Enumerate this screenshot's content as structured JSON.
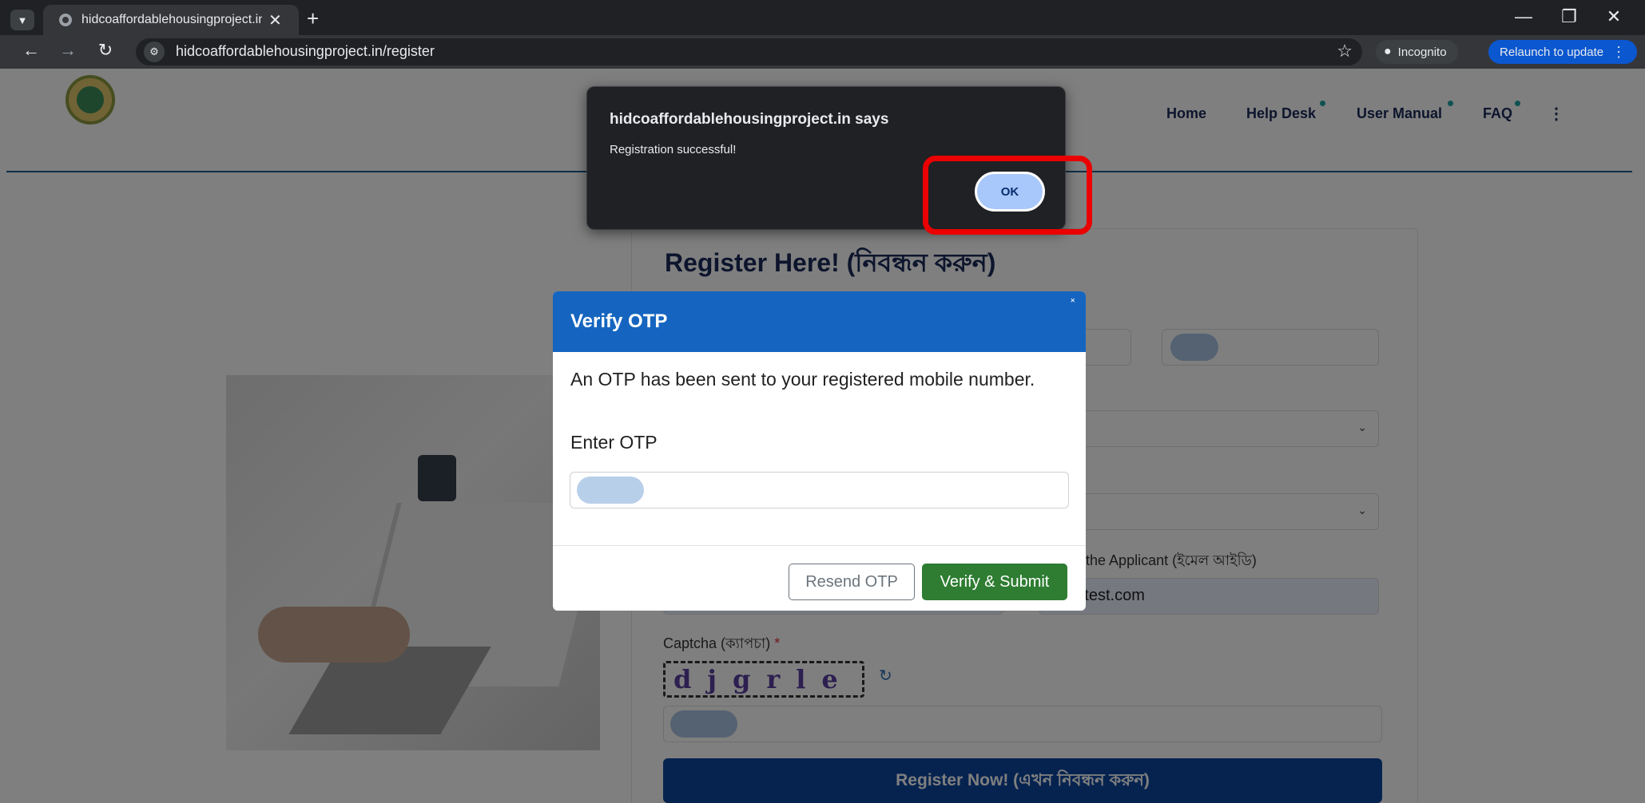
{
  "browser": {
    "tab_title": "hidcoaffordablehousingproject.in",
    "tab_close": "✕",
    "new_tab": "+",
    "url": "hidcoaffordablehousingproject.in/register",
    "incognito_label": "Incognito",
    "relaunch_label": "Relaunch to update",
    "icons": [
      "chevron-down-icon",
      "globe-icon",
      "close-icon",
      "plus-icon",
      "back-icon",
      "forward-icon",
      "reload-icon",
      "site-info-icon",
      "star-icon",
      "incognito-icon",
      "more-icon",
      "minimize-icon",
      "restore-icon",
      "close-window-icon"
    ]
  },
  "nav": {
    "items": [
      "Home",
      "Help Desk",
      "User Manual",
      "FAQ"
    ],
    "more": "⋮"
  },
  "form": {
    "title": "Register Here! (নিবন্ধন করুন)",
    "select_partial": ")",
    "email_label_partial": "d of the Applicant (ইমেল আইডি)",
    "email_value_partial": "@test.com",
    "captcha_label": "Captcha (ক্যাপচা)",
    "captcha_required": "*",
    "captcha_text": "djgrle",
    "register_button": "Register Now! (এখন নিবন্ধন করুন)"
  },
  "otp_modal": {
    "title": "Verify OTP",
    "close": "˟",
    "message": "An OTP has been sent to your registered mobile number.",
    "input_label": "Enter OTP",
    "resend_button": "Resend OTP",
    "verify_button": "Verify & Submit"
  },
  "alert": {
    "title": "hidcoaffordablehousingproject.in says",
    "message": "Registration successful!",
    "ok_button": "OK"
  },
  "colors": {
    "accent_blue": "#1565c0",
    "verify_green": "#2e7d32",
    "highlight_red": "#ea0000",
    "register_blue": "#0d47a1"
  }
}
